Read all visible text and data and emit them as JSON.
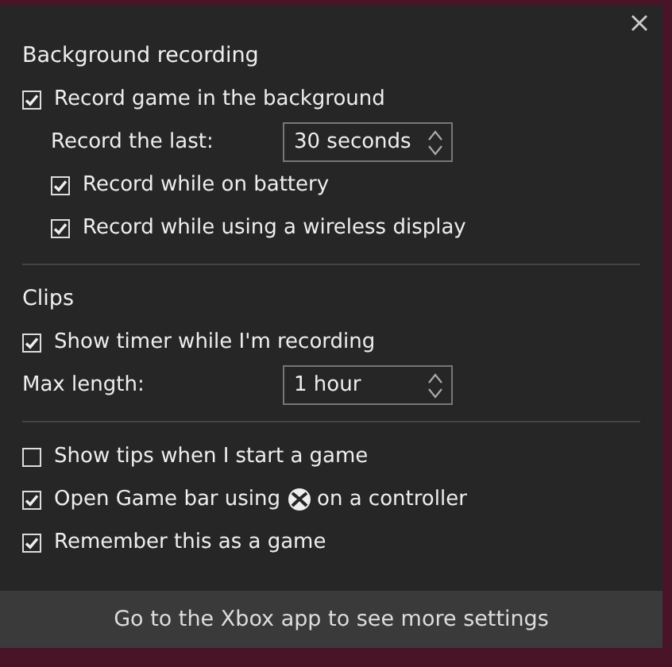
{
  "sections": [
    {
      "title": "Background recording",
      "rows": [
        {
          "kind": "checkbox",
          "label": "Record game in the background",
          "checked": true,
          "children": [
            {
              "kind": "select",
              "label": "Record the last:",
              "value": "30 seconds"
            },
            {
              "kind": "checkbox",
              "label": "Record while on battery",
              "checked": true
            },
            {
              "kind": "checkbox",
              "label": "Record while using a wireless display",
              "checked": true
            }
          ]
        }
      ]
    },
    {
      "title": "Clips",
      "rows": [
        {
          "kind": "checkbox",
          "label": "Show timer while I'm recording",
          "checked": true
        },
        {
          "kind": "select",
          "label": "Max length:",
          "value": "1 hour"
        }
      ]
    },
    {
      "rows": [
        {
          "kind": "checkbox",
          "label": "Show tips when I start a game",
          "checked": false
        },
        {
          "kind": "checkbox",
          "label": "Open Game bar using",
          "label_after": "on a controller",
          "checked": true
        },
        {
          "kind": "checkbox",
          "label": "Remember this as a game",
          "checked": true
        }
      ]
    }
  ],
  "footer_link": "Go to the Xbox app to see more settings"
}
